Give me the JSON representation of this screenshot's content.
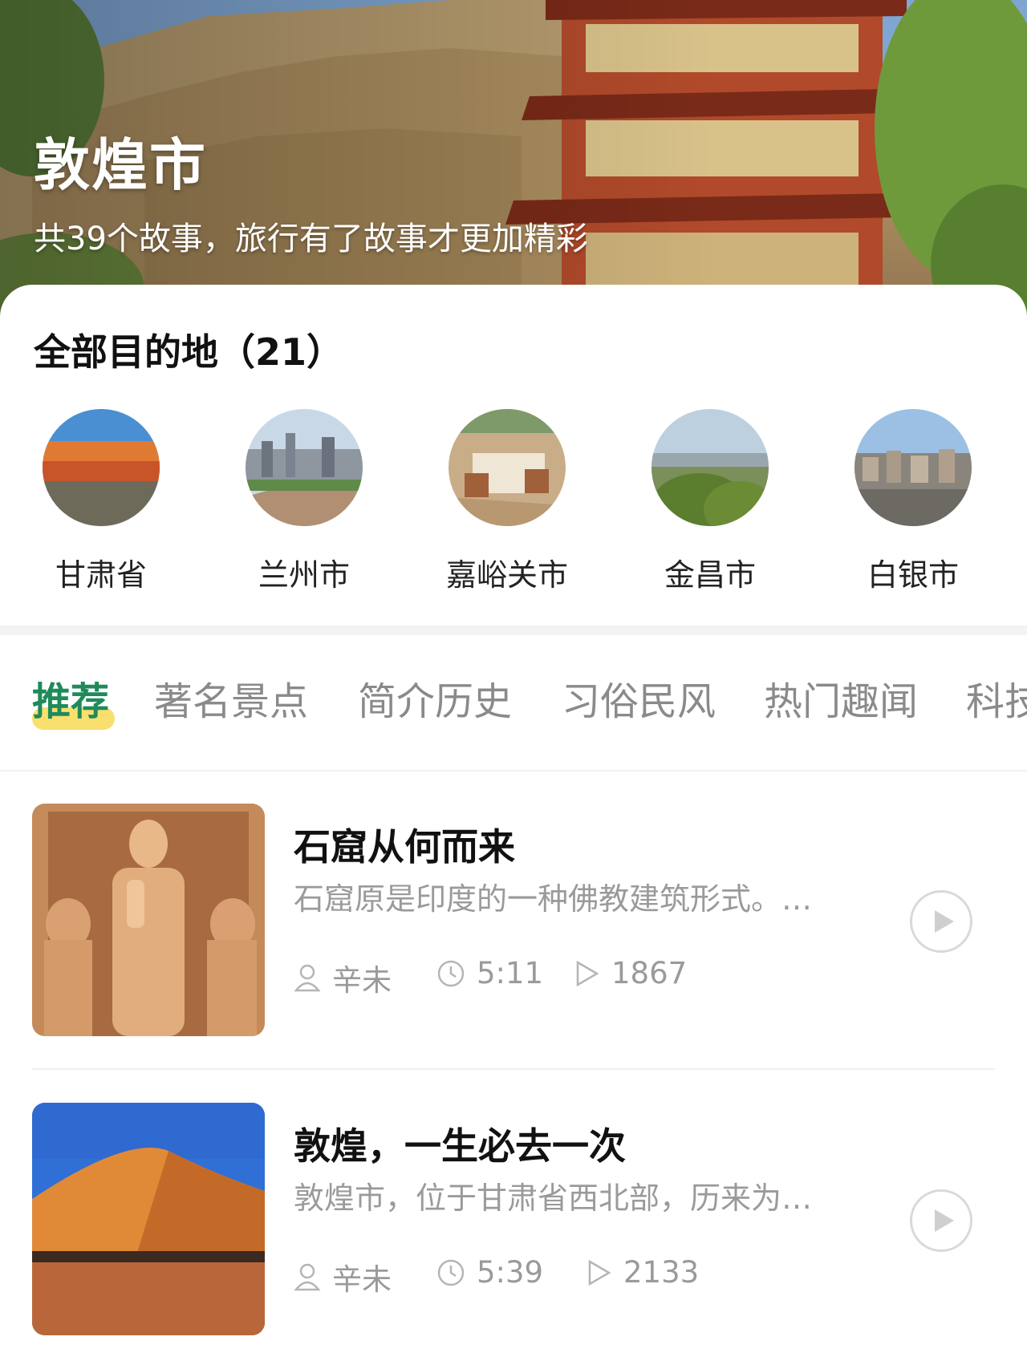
{
  "hero": {
    "title": "敦煌市",
    "subtitle": "共39个故事，旅行有了故事才更加精彩"
  },
  "destinations": {
    "heading": "全部目的地（21）",
    "items": [
      {
        "label": "甘肃省"
      },
      {
        "label": "兰州市"
      },
      {
        "label": "嘉峪关市"
      },
      {
        "label": "金昌市"
      },
      {
        "label": "白银市"
      }
    ]
  },
  "tabs": [
    {
      "label": "推荐",
      "active": true
    },
    {
      "label": "著名景点"
    },
    {
      "label": "简介历史"
    },
    {
      "label": "习俗民风"
    },
    {
      "label": "热门趣闻"
    },
    {
      "label": "科技"
    }
  ],
  "stories": [
    {
      "title": "石窟从何而来",
      "description": "石窟原是印度的一种佛教建筑形式。…",
      "author": "辛未",
      "duration": "5:11",
      "plays": "1867"
    },
    {
      "title": "敦煌，一生必去一次",
      "description": "敦煌市，位于甘肃省西北部，历来为…",
      "author": "辛未",
      "duration": "5:39",
      "plays": "2133"
    }
  ],
  "colors": {
    "accent_green": "#1f8a5a",
    "tab_highlight": "#f8df6e",
    "muted_text": "#9a9a9a"
  },
  "icons": {
    "author": "user-icon",
    "duration": "clock-icon",
    "plays": "play-count-icon",
    "play_button": "play-icon"
  }
}
